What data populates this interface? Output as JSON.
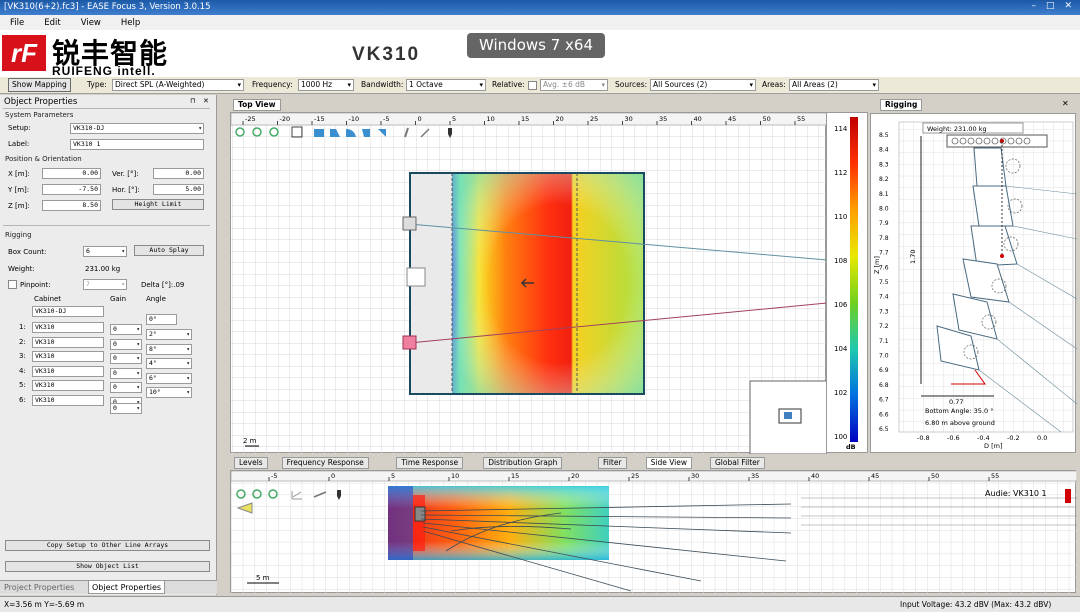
{
  "window": {
    "title": "[VK310(6+2).fc3] - EASE Focus 3, Version 3.0.15",
    "minimize": "–",
    "maximize": "□",
    "close": "✕"
  },
  "menu": [
    "File",
    "Edit",
    "View",
    "Help"
  ],
  "banner": {
    "logo_letters": "rF",
    "brand_cn": "锐丰智能",
    "brand_en": "RUIFENG intell.",
    "product": "VK310",
    "os_tag": "Windows 7 x64"
  },
  "toolbar": {
    "show_mapping": "Show Mapping",
    "type_label": "Type:",
    "type_value": "Direct SPL (A-Weighted)",
    "freq_label": "Frequency:",
    "freq_value": "1000 Hz",
    "bw_label": "Bandwidth:",
    "bw_value": "1 Octave",
    "rel_label": "Relative:",
    "avg_value": "Avg. ±6 dB",
    "src_label": "Sources:",
    "src_value": "All Sources (2)",
    "areas_label": "Areas:",
    "areas_value": "All Areas (2)"
  },
  "object_properties": {
    "title": "Object Properties",
    "pin": "⊓",
    "close": "✕",
    "system_parameters": "System Parameters",
    "setup_label": "Setup:",
    "setup_value": "VK310-DJ",
    "label_label": "Label:",
    "label_value": "VK310 1",
    "pos_header": "Position & Orientation",
    "x_label": "X [m]:",
    "x_value": "0.00",
    "y_label": "Y [m]:",
    "y_value": "-7.50",
    "z_label": "Z [m]:",
    "z_value": "8.50",
    "ver_label": "Ver. [°]:",
    "ver_value": "0.00",
    "hor_label": "Hor. [°]:",
    "hor_value": "5.00",
    "height_limit": "Height Limit",
    "rigging_header": "Rigging",
    "box_count_label": "Box Count:",
    "box_count_value": "6",
    "auto_splay": "Auto Splay",
    "weight_label": "Weight:",
    "weight_value": "231.00 kg",
    "pinpoint_label": "Pinpoint:",
    "pinpoint_value": "7",
    "delta_label": "Delta [°]:.09",
    "col_cabinet": "Cabinet",
    "col_gain": "Gain",
    "col_angle": "Angle",
    "top_cabinet": "VK310-DJ",
    "top_angle": "0°",
    "rows": [
      {
        "num": "1:",
        "cabinet": "VK310",
        "gain": "0",
        "angle": "2°"
      },
      {
        "num": "2:",
        "cabinet": "VK310",
        "gain": "0",
        "angle": "8°"
      },
      {
        "num": "3:",
        "cabinet": "VK310",
        "gain": "0",
        "angle": "4°"
      },
      {
        "num": "4:",
        "cabinet": "VK310",
        "gain": "0",
        "angle": "6°"
      },
      {
        "num": "5:",
        "cabinet": "VK310",
        "gain": "0",
        "angle": "10°"
      },
      {
        "num": "6:",
        "cabinet": "VK310",
        "gain": "0",
        "angle": ""
      }
    ],
    "extra_gain": "0",
    "copy_setup": "Copy Setup to Other Line Arrays",
    "show_object_list": "Show Object List"
  },
  "panel_tabs": [
    "Project Properties",
    "Object Properties"
  ],
  "top_view": {
    "tab": "Top View",
    "x_ticks": [
      "-25",
      "-20",
      "-15",
      "-10",
      "-5",
      "0",
      "5",
      "10",
      "15",
      "20",
      "25",
      "30",
      "35",
      "40",
      "45",
      "50",
      "55"
    ],
    "scale": "2 m"
  },
  "color_scale": {
    "ticks": [
      "114",
      "112",
      "110",
      "108",
      "106",
      "104",
      "102",
      "100"
    ],
    "unit": "dB"
  },
  "rigging": {
    "tab": "Rigging",
    "weight": "Weight: 231.00 kg",
    "height_dim": "1.70",
    "width_dim": "0.77",
    "bottom_angle": "Bottom Angle: 35.0 °",
    "above_ground": "6.80 m above ground",
    "z_axis_label": "Z [m]",
    "d_axis_label": "D [m]",
    "z_ticks": [
      "8.5",
      "8.4",
      "8.3",
      "8.2",
      "8.1",
      "8.0",
      "7.9",
      "7.8",
      "7.7",
      "7.6",
      "7.5",
      "7.4",
      "7.3",
      "7.2",
      "7.1",
      "7.0",
      "6.9",
      "6.8",
      "6.7",
      "6.6",
      "6.5"
    ],
    "d_ticks": [
      "-0.8",
      "-0.6",
      "-0.4",
      "-0.2",
      "0.0"
    ]
  },
  "bottom_tabs": [
    "Levels",
    "Frequency Response",
    "Time Response",
    "Distribution Graph",
    "Filter",
    "Side View",
    "Global Filter"
  ],
  "side_view": {
    "x_ticks": [
      "-5",
      "0",
      "5",
      "10",
      "15",
      "20",
      "25",
      "30",
      "35",
      "40",
      "45",
      "50",
      "55"
    ],
    "audience": "Audie: VK310 1",
    "scale": "5 m"
  },
  "status": {
    "coords": "X=3.56 m Y=-5.69 m",
    "voltage": "Input Voltage: 43.2 dBV (Max: 43.2 dBV)"
  },
  "colors": {
    "titlebar": "#1c5aa8",
    "logo_red": "#d7101a",
    "spl_max": "#e00000",
    "spl_min": "#0000c0"
  }
}
